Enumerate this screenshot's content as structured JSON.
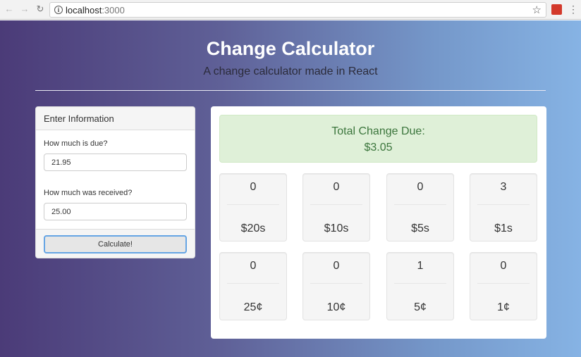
{
  "browser": {
    "url_host": "localhost",
    "url_port": ":3000",
    "info_glyph": "i",
    "star_glyph": "☆",
    "menu_glyph": "⋮",
    "back_glyph": "←",
    "forward_glyph": "→",
    "reload_glyph": "↻"
  },
  "header": {
    "title": "Change Calculator",
    "subtitle": "A change calculator made in React"
  },
  "form": {
    "panel_title": "Enter Information",
    "due_label": "How much is due?",
    "due_value": "21.95",
    "received_label": "How much was received?",
    "received_value": "25.00",
    "calculate_label": "Calculate!"
  },
  "result": {
    "total_label": "Total Change Due:",
    "total_value": "$3.05",
    "denominations": [
      {
        "count": "0",
        "label": "$20s"
      },
      {
        "count": "0",
        "label": "$10s"
      },
      {
        "count": "0",
        "label": "$5s"
      },
      {
        "count": "3",
        "label": "$1s"
      },
      {
        "count": "0",
        "label": "25¢"
      },
      {
        "count": "0",
        "label": "10¢"
      },
      {
        "count": "1",
        "label": "5¢"
      },
      {
        "count": "0",
        "label": "1¢"
      }
    ]
  },
  "colors": {
    "gradient_start": "#4b3b78",
    "gradient_end": "#86b3e4",
    "success_bg": "#dff0d8",
    "success_text": "#3c763d",
    "button_focus_border": "#66a5e4"
  }
}
